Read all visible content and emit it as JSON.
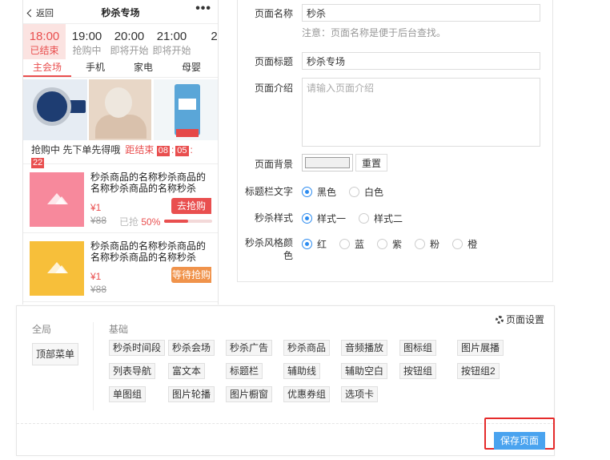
{
  "phone": {
    "back_label": "返回",
    "title": "秒杀专场",
    "more": "•••",
    "times": [
      {
        "time": "18:00",
        "status": "已结束"
      },
      {
        "time": "19:00",
        "status": "抢购中"
      },
      {
        "time": "20:00",
        "status": "即将开始"
      },
      {
        "time": "21:00",
        "status": "即将开始"
      },
      {
        "time": "2",
        "status": ""
      }
    ],
    "tabs": [
      "主会场",
      "手机",
      "家电",
      "母婴"
    ],
    "status_text": "抢购中 先下单先得哦",
    "end_label": "距结束",
    "countdown": {
      "h": "08",
      "m": "05",
      "s": "22"
    },
    "goods": [
      {
        "name": "秒杀商品的名称秒杀商品的名称秒杀商品的名称秒杀",
        "price": "¥1",
        "old": "¥88",
        "sold_label": "已抢",
        "percent": "50%",
        "progress": 0.5,
        "button": "去抢购"
      },
      {
        "name": "秒杀商品的名称秒杀商品的名称秒杀商品的名称秒杀",
        "price": "¥1",
        "old": "¥88",
        "button": "等待抢购"
      }
    ]
  },
  "form": {
    "page_name_label": "页面名称",
    "page_name_value": "秒杀",
    "page_name_note": "注意：页面名称是便于后台查找。",
    "page_title_label": "页面标题",
    "page_title_value": "秒杀专场",
    "intro_label": "页面介绍",
    "intro_placeholder": "请输入页面介绍",
    "bg_label": "页面背景",
    "bg_color": "#f0f0f0",
    "reset_label": "重置",
    "title_text_label": "标题栏文字",
    "title_text_options": [
      "黑色",
      "白色"
    ],
    "style_label": "秒杀样式",
    "style_options": [
      "样式一",
      "样式二"
    ],
    "color_label_1": "秒杀风格颜",
    "color_label_2": "色",
    "color_options": [
      "红",
      "蓝",
      "紫",
      "粉",
      "橙"
    ]
  },
  "components": {
    "page_settings": "页面设置",
    "global_label": "全局",
    "basic_label": "基础",
    "global_items": [
      "顶部菜单"
    ],
    "basic_items": [
      [
        "秒杀时间段",
        "秒杀会场",
        "秒杀广告",
        "秒杀商品",
        "音频播放",
        "图标组",
        "图片展播"
      ],
      [
        "列表导航",
        "富文本",
        "标题栏",
        "辅助线",
        "辅助空白",
        "按钮组",
        "按钮组2"
      ],
      [
        "单图组",
        "图片轮播",
        "图片橱窗",
        "优惠券组",
        "选项卡"
      ]
    ],
    "save_label": "保存页面"
  },
  "colors": {
    "accent_red": "#e94f4f",
    "radio_blue": "#2d8cf0",
    "save_blue": "#4aa3ef",
    "highlight_red": "#e52b2b"
  }
}
